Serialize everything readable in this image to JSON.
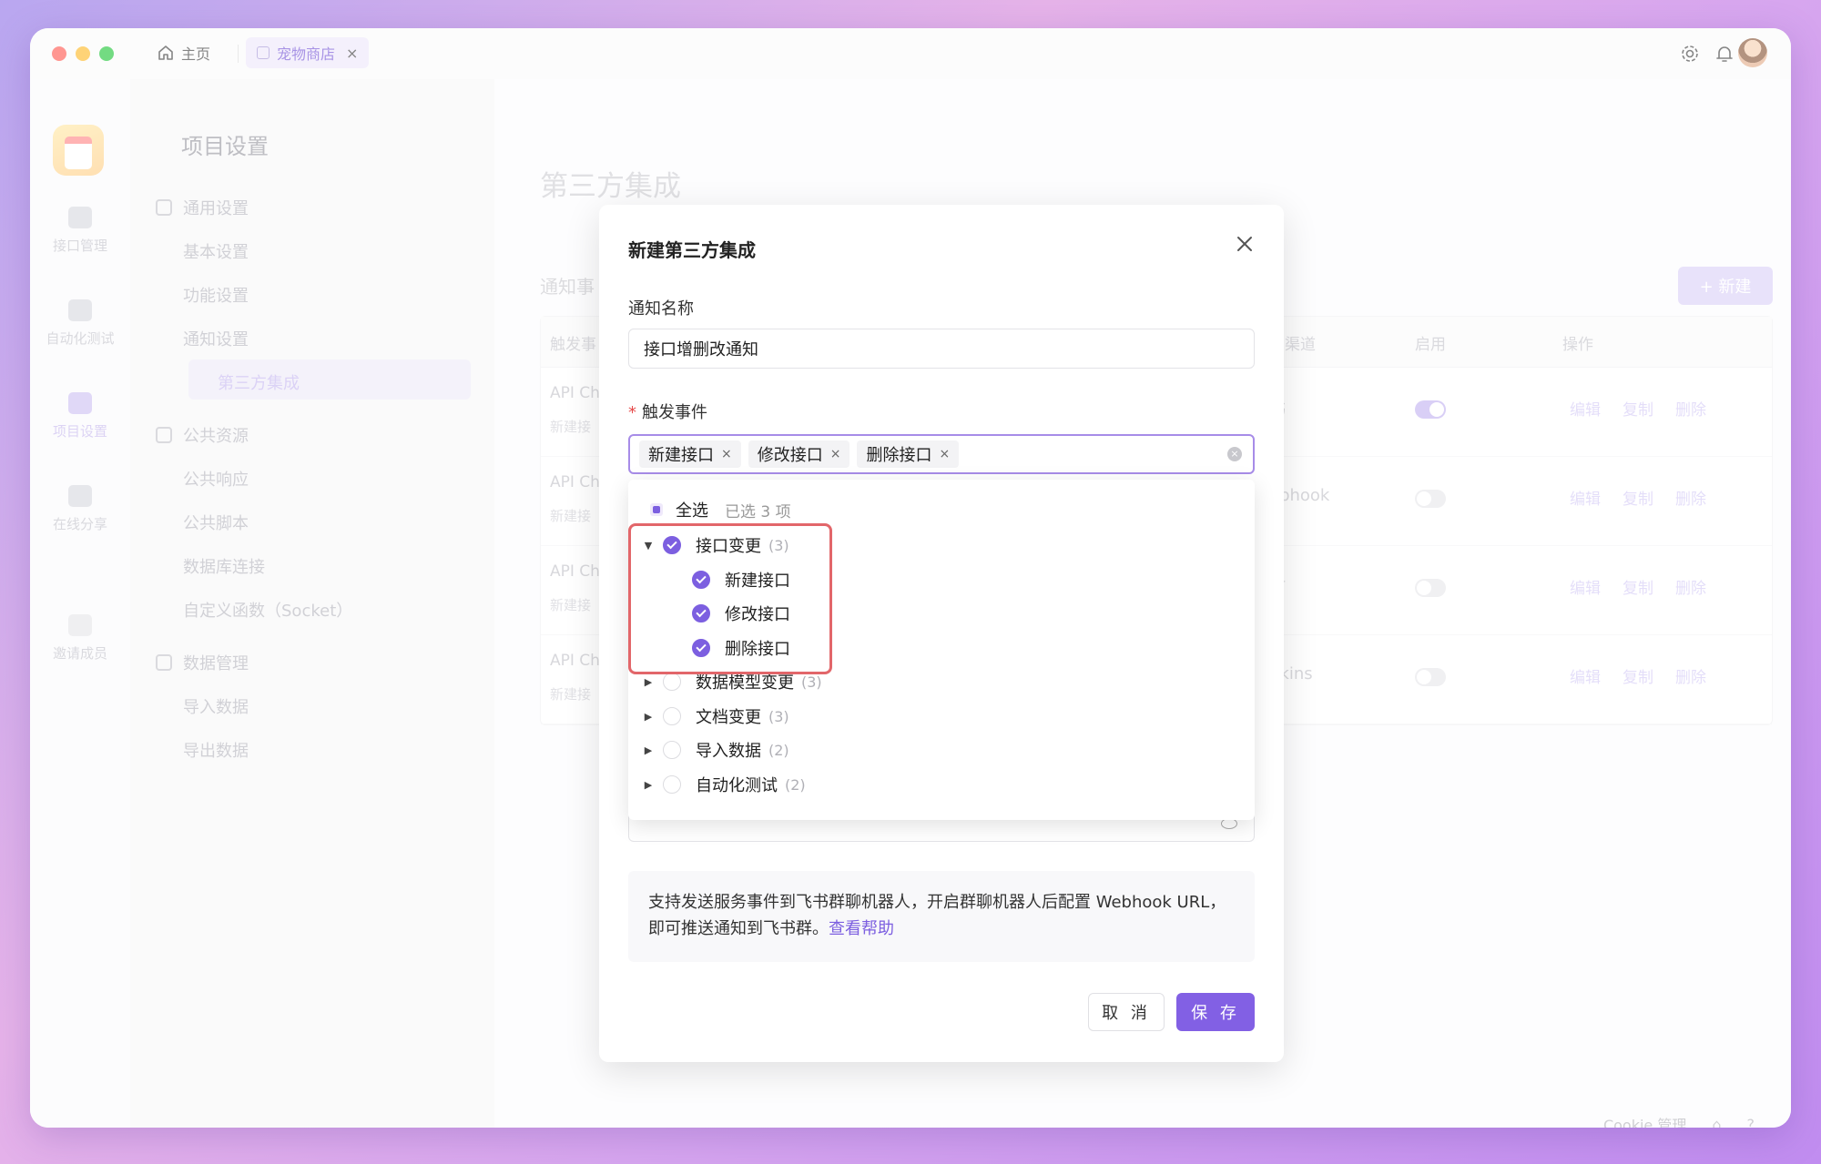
{
  "titlebar": {
    "home_tab": "主页",
    "active_tab": "宠物商店",
    "active_tab_close": "×"
  },
  "rail": {
    "items": [
      {
        "label": "接口管理"
      },
      {
        "label": "自动化测试"
      },
      {
        "label": "项目设置"
      },
      {
        "label": "在线分享"
      },
      {
        "label": "邀请成员"
      }
    ]
  },
  "sidebar": {
    "title": "项目设置",
    "groups": [
      {
        "label": "通用设置"
      },
      {
        "label": "公共资源"
      },
      {
        "label": "数据管理"
      }
    ],
    "items": [
      "基本设置",
      "功能设置",
      "通知设置",
      "第三方集成",
      "公共响应",
      "公共脚本",
      "数据库连接",
      "自定义函数（Socket）",
      "导入数据",
      "导出数据"
    ]
  },
  "main": {
    "title": "第三方集成",
    "subtitle": "通知事",
    "new_button": "+ 新建",
    "columns": [
      "触发事",
      "知渠道",
      "启用",
      "操作"
    ],
    "rows": [
      {
        "name": "API Ch",
        "sub": "新建接",
        "channel": "书",
        "enabled": true
      },
      {
        "name": "API Ch",
        "sub": "新建接",
        "channel": "ebhook",
        "enabled": false
      },
      {
        "name": "API Ch",
        "sub": "新建接",
        "channel": "钉",
        "enabled": false
      },
      {
        "name": "API Ch",
        "sub": "新建接",
        "channel": "nkins",
        "enabled": false
      }
    ],
    "ops": [
      "编辑",
      "复制",
      "删除"
    ],
    "footer": {
      "cookie": "Cookie 管理"
    }
  },
  "modal": {
    "title": "新建第三方集成",
    "name_label": "通知名称",
    "name_value": "接口增删改通知",
    "events_label": "触发事件",
    "required_mark": "*",
    "chips": [
      "新建接口",
      "修改接口",
      "删除接口"
    ],
    "chip_remove": "×",
    "clear_icon": "×",
    "dropdown": {
      "select_all": "全选",
      "selected_count": "已选 3 项",
      "groups": [
        {
          "label": "接口变更",
          "count": "(3)",
          "checked": true,
          "expanded": true,
          "children": [
            "新建接口",
            "修改接口",
            "删除接口"
          ]
        },
        {
          "label": "数据模型变更",
          "count": "(3)",
          "checked": false,
          "expanded": false
        },
        {
          "label": "文档变更",
          "count": "(3)",
          "checked": false,
          "expanded": false
        },
        {
          "label": "导入数据",
          "count": "(2)",
          "checked": false,
          "expanded": false
        },
        {
          "label": "自动化测试",
          "count": "(2)",
          "checked": false,
          "expanded": false
        }
      ]
    },
    "info_text": "支持发送服务事件到飞书群聊机器人，开启群聊机器人后配置 Webhook URL，即可推送通知到飞书群。",
    "info_link": "查看帮助",
    "cancel": "取 消",
    "save": "保 存"
  },
  "colors": {
    "accent": "#7c5fe0",
    "highlight": "#e2666a"
  }
}
